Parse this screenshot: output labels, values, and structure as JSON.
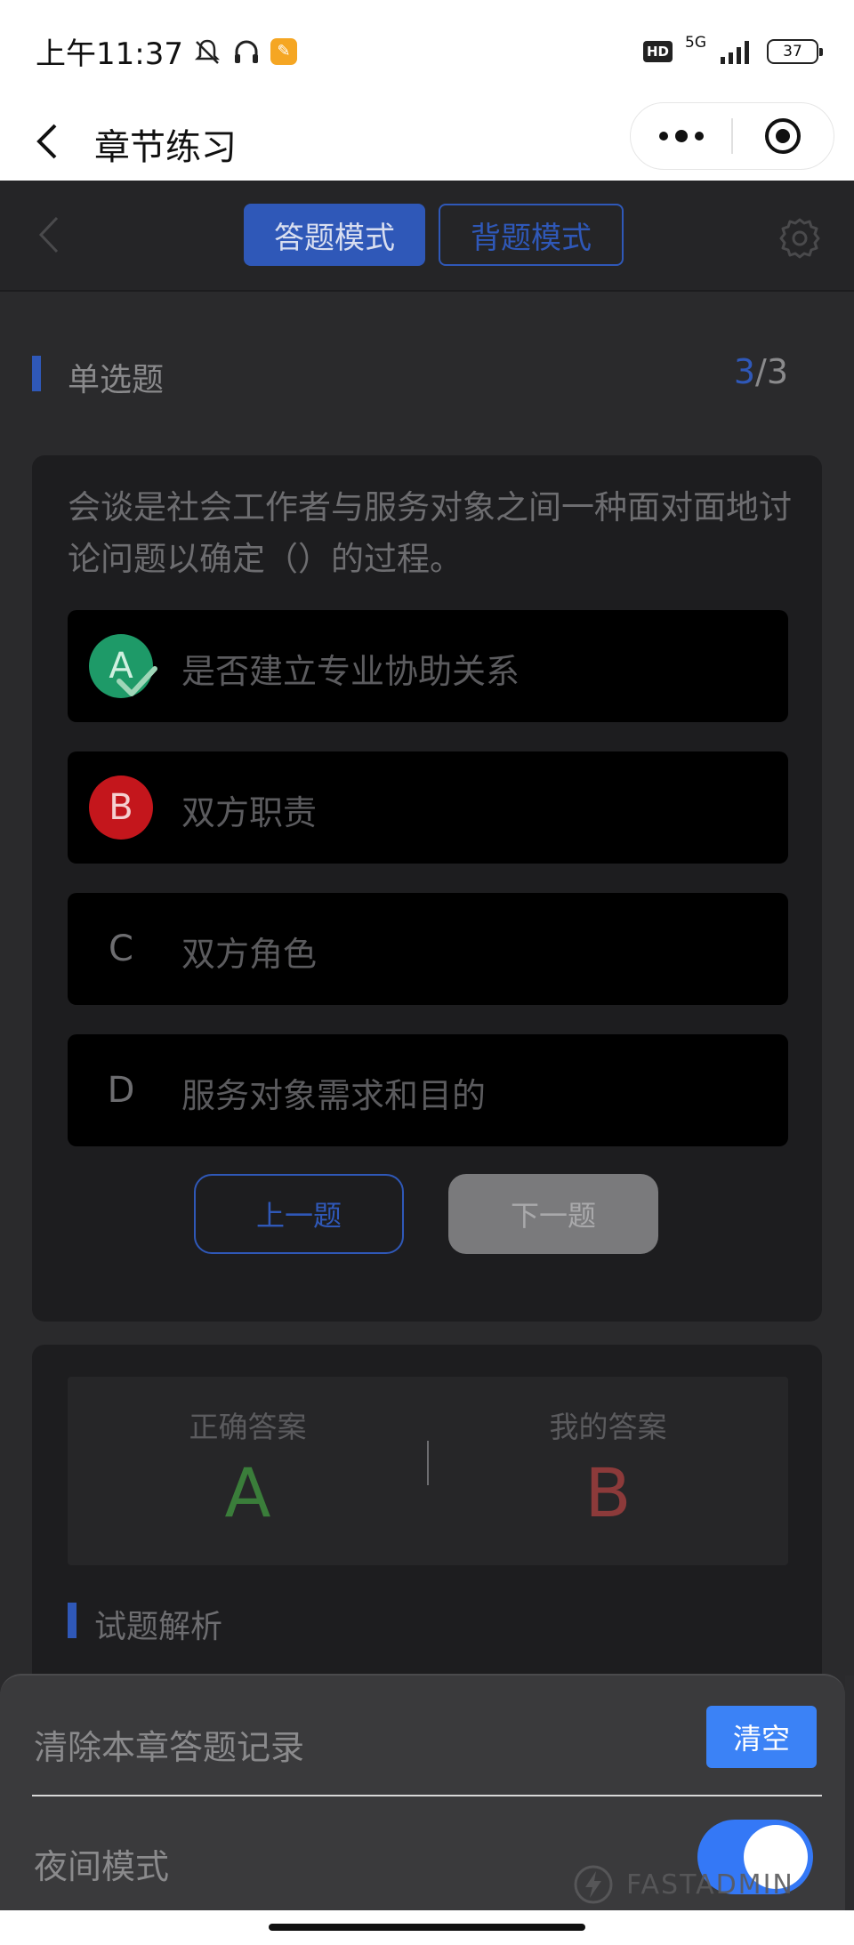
{
  "status_bar": {
    "time": "上午11:37",
    "network": "5G",
    "hd": "HD",
    "battery": "37"
  },
  "mp_nav": {
    "title": "章节练习"
  },
  "header": {
    "tab_answer": "答题模式",
    "tab_memorize": "背题模式",
    "active_tab": "答题模式"
  },
  "question": {
    "type": "单选题",
    "current": "3",
    "total": "/3",
    "text": "会谈是社会工作者与服务对象之间一种面对面地讨论问题以确定（）的过程。",
    "options": [
      {
        "letter": "A",
        "text": "是否建立专业协助关系",
        "state": "correct"
      },
      {
        "letter": "B",
        "text": "双方职责",
        "state": "wrong"
      },
      {
        "letter": "C",
        "text": "双方角色",
        "state": "none"
      },
      {
        "letter": "D",
        "text": "服务对象需求和目的",
        "state": "none"
      }
    ],
    "prev_label": "上一题",
    "next_label": "下一题"
  },
  "answer": {
    "correct_label": "正确答案",
    "correct_value": "A",
    "mine_label": "我的答案",
    "mine_value": "B",
    "analysis_label": "试题解析"
  },
  "sheet": {
    "clear_label": "清除本章答题记录",
    "clear_button": "清空",
    "night_label": "夜间模式",
    "night_mode": true
  },
  "watermark": "FASTADMIN",
  "colors": {
    "accent": "#2f58b8",
    "correct": "#1e9a68",
    "wrong": "#c4161c",
    "toggle_on": "#3478f6"
  }
}
